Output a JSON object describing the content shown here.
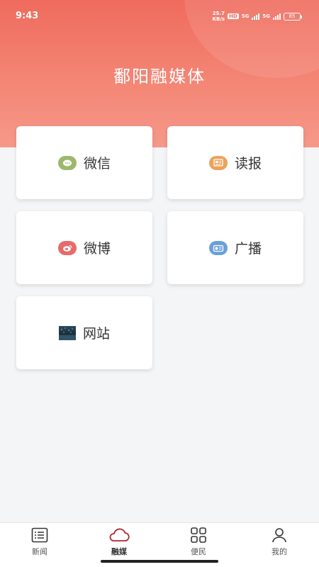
{
  "status": {
    "time": "9:43",
    "net_speed_value": "25.7",
    "net_speed_unit": "KB/s",
    "hd": "HD",
    "signal1": "5G",
    "signal2": "5G",
    "battery": "85"
  },
  "header": {
    "title": "鄱阳融媒体"
  },
  "cards": [
    {
      "label": "微信",
      "icon": "wechat-icon",
      "color": "#9cb86c"
    },
    {
      "label": "读报",
      "icon": "newspaper-icon",
      "color": "#eda25a"
    },
    {
      "label": "微博",
      "icon": "weibo-icon",
      "color": "#e76a6a"
    },
    {
      "label": "广播",
      "icon": "radio-icon",
      "color": "#6aa0d8"
    },
    {
      "label": "网站",
      "icon": "website-thumbnail-icon",
      "color": "#1f3a4a"
    }
  ],
  "tabbar": {
    "items": [
      {
        "label": "新闻",
        "icon": "news-list-icon",
        "active": false
      },
      {
        "label": "融媒",
        "icon": "cloud-icon",
        "active": true
      },
      {
        "label": "便民",
        "icon": "grid-icon",
        "active": false
      },
      {
        "label": "我的",
        "icon": "person-icon",
        "active": false
      }
    ]
  },
  "colors": {
    "accent": "#ef6b5d",
    "active_tab": "#b3262e"
  }
}
